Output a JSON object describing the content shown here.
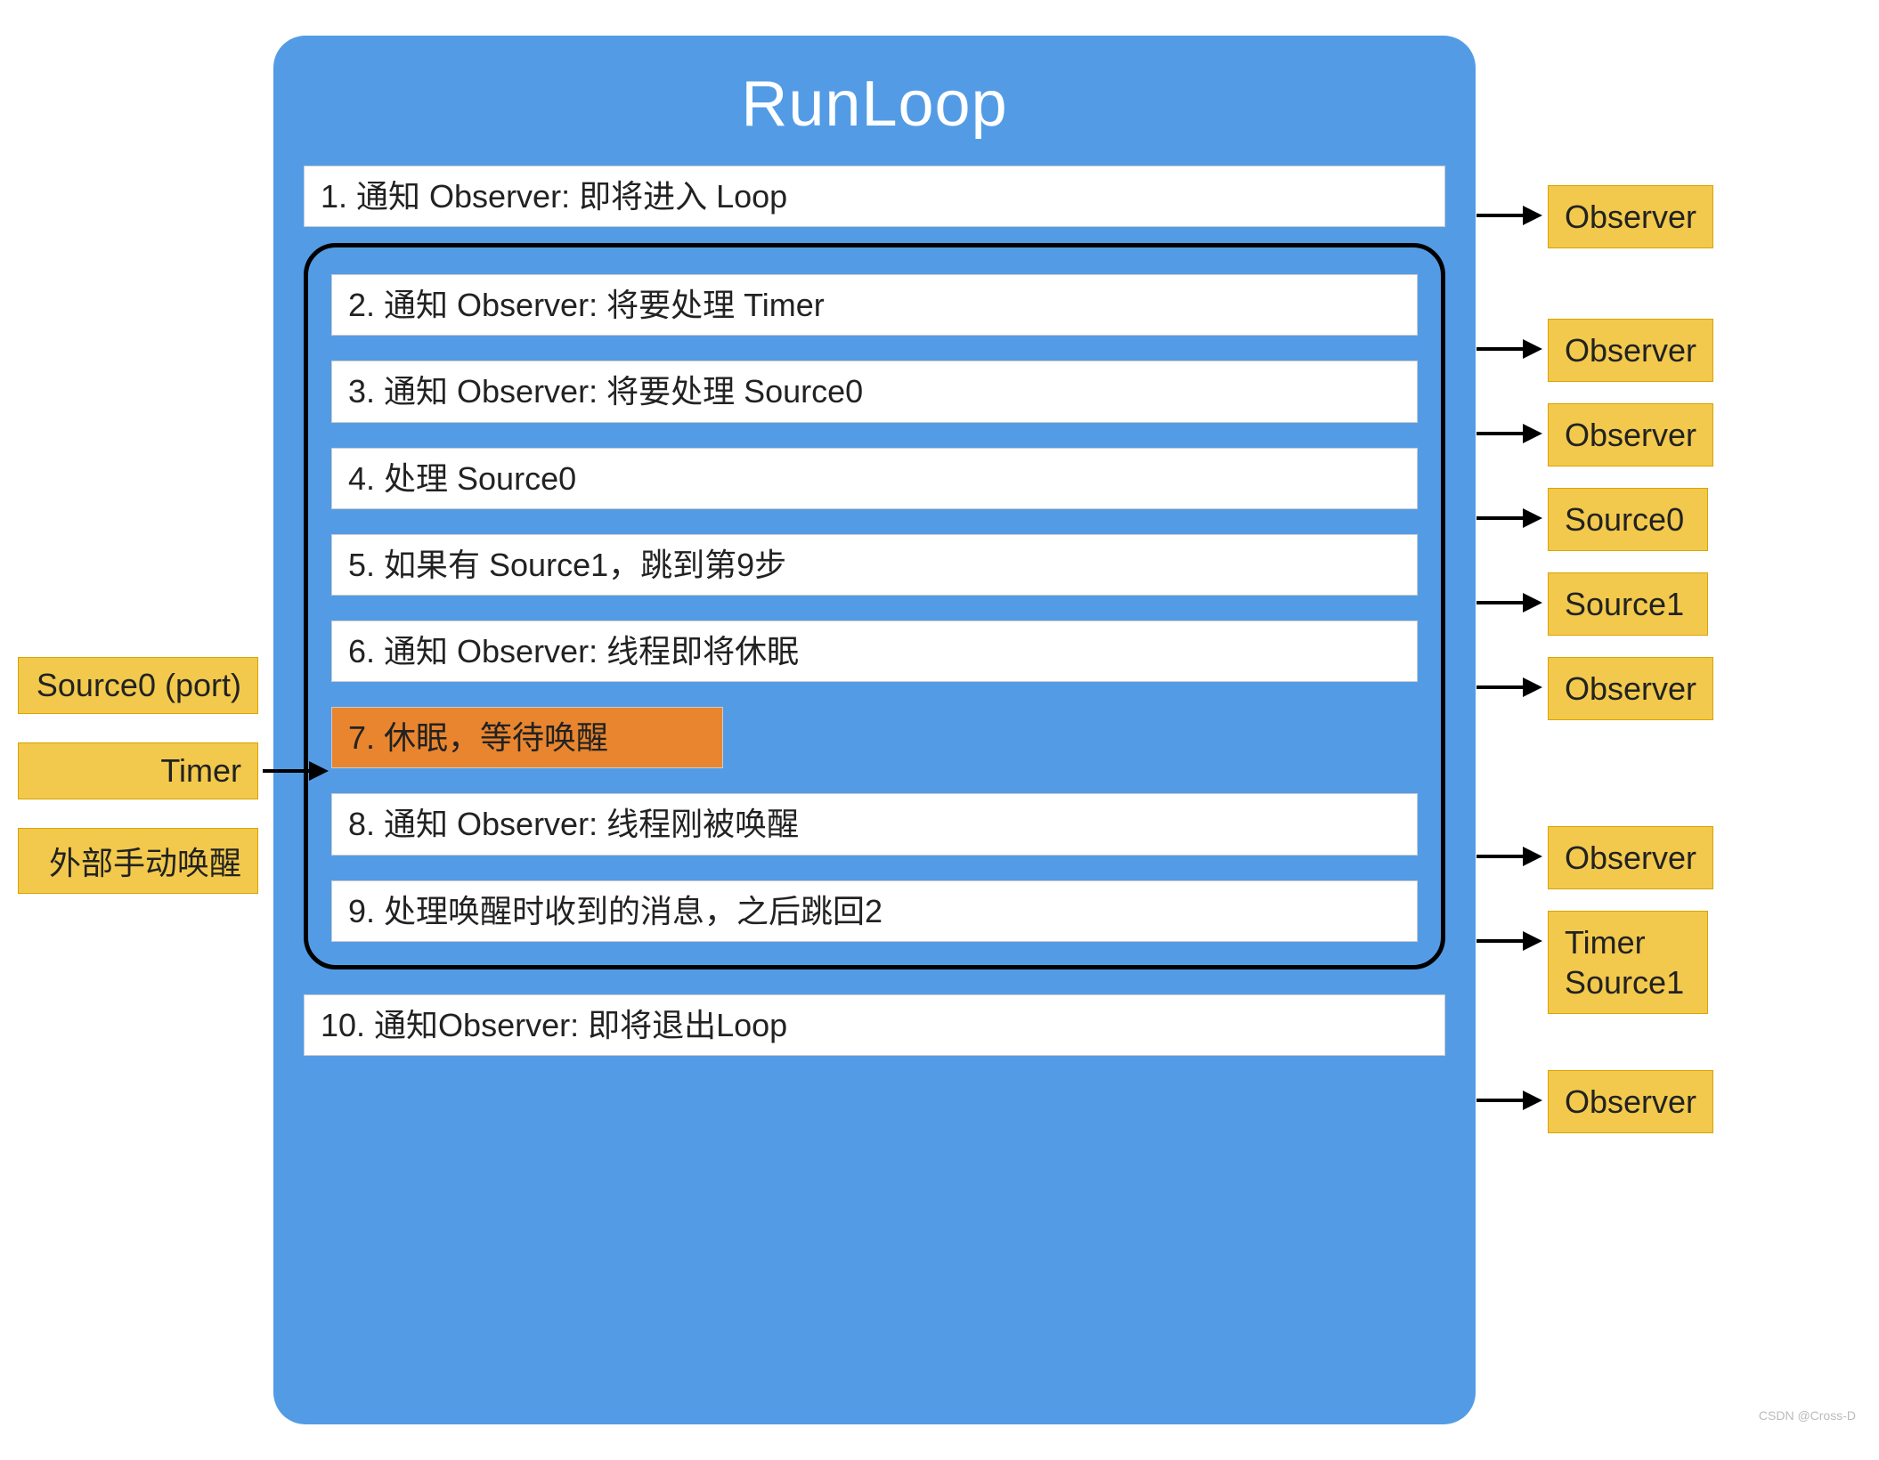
{
  "title": "RunLoop",
  "steps": {
    "s1": "1. 通知 Observer: 即将进入 Loop",
    "s2": "2. 通知 Observer: 将要处理 Timer",
    "s3": "3. 通知 Observer: 将要处理 Source0",
    "s4": "4. 处理 Source0",
    "s5": "5. 如果有 Source1，跳到第9步",
    "s6": "6. 通知 Observer: 线程即将休眠",
    "s7": "7. 休眠，等待唤醒",
    "s8": "8. 通知 Observer: 线程刚被唤醒",
    "s9": "9. 处理唤醒时收到的消息，之后跳回2",
    "s10": "10. 通知Observer: 即将退出Loop"
  },
  "right_labels": {
    "r1": "Observer",
    "r2": "Observer",
    "r3": "Observer",
    "r4": "Source0",
    "r5": "Source1",
    "r6": "Observer",
    "r8": "Observer",
    "r9": "Timer\nSource1",
    "r10": "Observer"
  },
  "left_labels": {
    "l1": "Source0 (port)",
    "l2": "Timer",
    "l3": "外部手动唤醒"
  },
  "colors": {
    "panel": "#539ce5",
    "yellow": "#f2c94c",
    "orange": "#e8852e"
  },
  "watermark": "CSDN @Cross-D"
}
